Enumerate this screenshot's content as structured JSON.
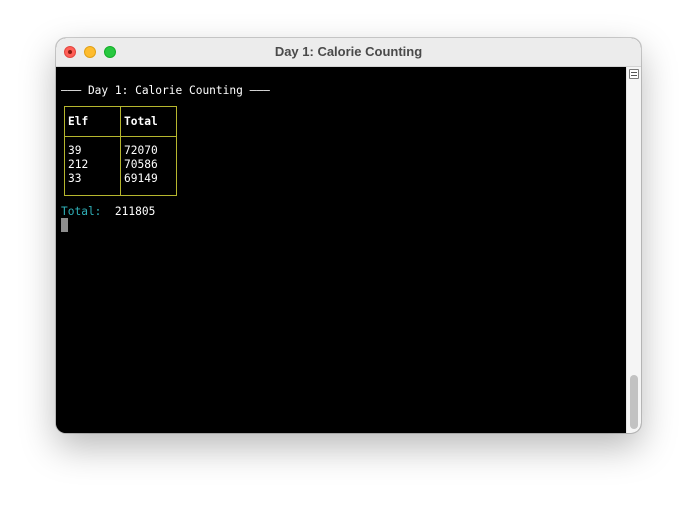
{
  "window": {
    "title": "Day 1: Calorie Counting"
  },
  "terminal": {
    "header": "——— Day 1: Calorie Counting ———",
    "table": {
      "headers": [
        "Elf",
        "Total"
      ],
      "rows": [
        [
          "39",
          "72070"
        ],
        [
          "212",
          "70586"
        ],
        [
          "33",
          "69149"
        ]
      ]
    },
    "total_label": "Total:",
    "total_value": "211805"
  },
  "colors": {
    "background": "#000000",
    "text": "#ffffff",
    "table_border": "#b6b62e",
    "total_label": "#2fb0b8"
  },
  "icons": {
    "scroll_button": "split-pane-icon"
  }
}
